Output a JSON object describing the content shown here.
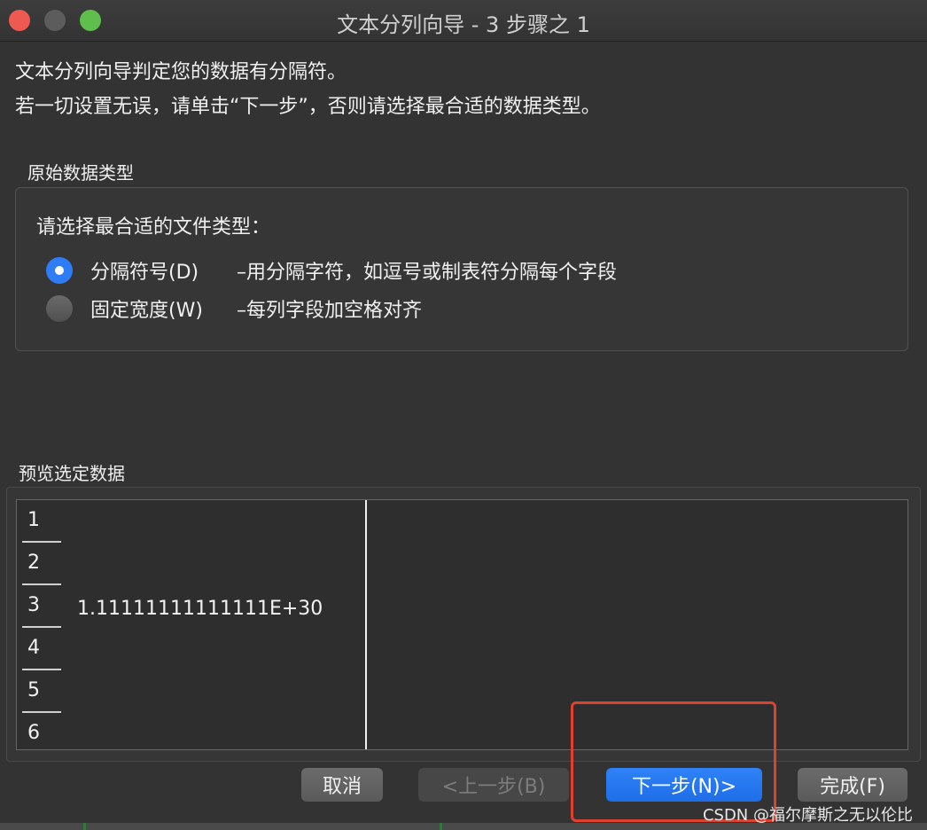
{
  "window": {
    "title": "文本分列向导 - 3 步骤之 1"
  },
  "intro": {
    "line1": "文本分列向导判定您的数据有分隔符。",
    "line2": "若一切设置无误，请单击“下一步”，否则请选择最合适的数据类型。"
  },
  "original_type": {
    "section_label": "原始数据类型",
    "prompt": "请选择最合适的文件类型：",
    "options": [
      {
        "label": "分隔符号(D)",
        "description": "–用分隔字符，如逗号或制表符分隔每个字段",
        "selected": true
      },
      {
        "label": "固定宽度(W)",
        "description": "–每列字段加空格对齐",
        "selected": false
      }
    ]
  },
  "preview": {
    "section_label": "预览选定数据",
    "row_numbers": [
      "1",
      "2",
      "3",
      "4",
      "5",
      "6"
    ],
    "cell_value": "1.11111111111111E+30"
  },
  "buttons": {
    "cancel": "取消",
    "back": "<上一步(B)",
    "next": "下一步(N)>",
    "finish": "完成(F)"
  },
  "watermark": "CSDN @福尔摩斯之无以伦比",
  "colors": {
    "accent": "#2e7cf6",
    "highlight": "#e0412f"
  }
}
